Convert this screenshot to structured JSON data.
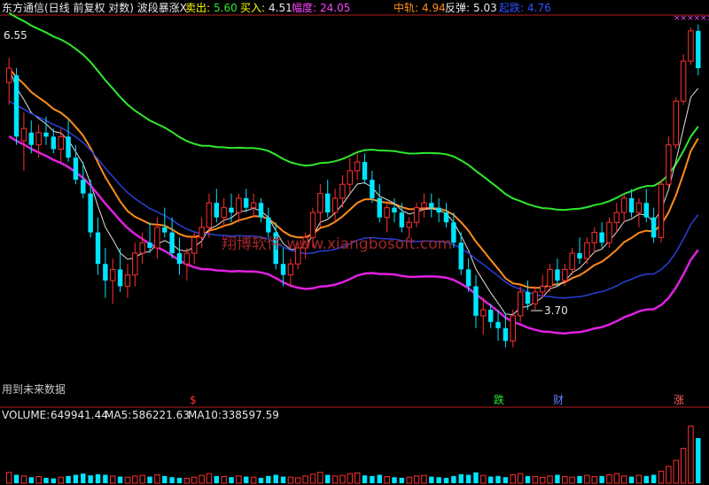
{
  "header": {
    "title": "东方通信(日线 前复权 对数) 波段暴涨X",
    "sell_label": "卖出:",
    "sell_value": "5.60",
    "buy_label": "买入:",
    "buy_value": "4.51",
    "amp_label": "幅度:",
    "amp_value": "24.05",
    "mid_label": "中轨:",
    "mid_value": "4.94",
    "rebound_label": "反弹:",
    "rebound_value": "5.03",
    "support_label": "起跌:",
    "support_value": "4.76"
  },
  "annotations": {
    "high": "6.55",
    "low": "3.70",
    "future_note": "用到未来数据",
    "watermark": "翔博软件 www.xiangbosoft.com",
    "signal_s": "$",
    "signal_fall": "跌",
    "signal_wealth": "财",
    "signal_rise": "涨",
    "x_marks": "××××××"
  },
  "volume_header": {
    "volume_label": "VOLUME:",
    "volume_value": "649941.44",
    "ma5_label": "MA5:",
    "ma5_value": "586221.63",
    "ma10_label": "MA10:",
    "ma10_value": "338597.59"
  },
  "colors": {
    "up": "#ff3030",
    "down": "#00e5ff",
    "green_line": "#2ee82e",
    "orange_line": "#ff8c1a",
    "white_line": "#e0e0e0",
    "blue_line": "#2a3fd8",
    "magenta_line": "#e020e0",
    "title": "#e8e8e8",
    "label_yellow": "#ffff00"
  },
  "chart_data": {
    "type": "candlestick",
    "price_range": [
      3.4,
      7.1
    ],
    "candles": [
      {
        "o": 6.2,
        "h": 6.55,
        "l": 5.9,
        "c": 6.4
      },
      {
        "o": 6.3,
        "h": 6.4,
        "l": 5.4,
        "c": 5.5
      },
      {
        "o": 5.45,
        "h": 5.8,
        "l": 5.1,
        "c": 5.6
      },
      {
        "o": 5.55,
        "h": 5.7,
        "l": 5.3,
        "c": 5.4
      },
      {
        "o": 5.4,
        "h": 5.65,
        "l": 5.25,
        "c": 5.55
      },
      {
        "o": 5.55,
        "h": 5.75,
        "l": 5.4,
        "c": 5.5
      },
      {
        "o": 5.5,
        "h": 5.6,
        "l": 5.3,
        "c": 5.35
      },
      {
        "o": 5.35,
        "h": 5.6,
        "l": 5.2,
        "c": 5.5
      },
      {
        "o": 5.5,
        "h": 5.7,
        "l": 5.2,
        "c": 5.25
      },
      {
        "o": 5.25,
        "h": 5.4,
        "l": 4.95,
        "c": 5.0
      },
      {
        "o": 5.0,
        "h": 5.2,
        "l": 4.8,
        "c": 4.85
      },
      {
        "o": 4.85,
        "h": 5.0,
        "l": 4.4,
        "c": 4.45
      },
      {
        "o": 4.45,
        "h": 4.6,
        "l": 4.05,
        "c": 4.15
      },
      {
        "o": 4.15,
        "h": 4.3,
        "l": 3.85,
        "c": 4.0
      },
      {
        "o": 4.0,
        "h": 4.2,
        "l": 3.8,
        "c": 4.1
      },
      {
        "o": 4.1,
        "h": 4.3,
        "l": 3.9,
        "c": 3.95
      },
      {
        "o": 3.95,
        "h": 4.15,
        "l": 3.85,
        "c": 4.05
      },
      {
        "o": 4.05,
        "h": 4.35,
        "l": 3.95,
        "c": 4.25
      },
      {
        "o": 4.25,
        "h": 4.45,
        "l": 4.15,
        "c": 4.35
      },
      {
        "o": 4.35,
        "h": 4.55,
        "l": 4.25,
        "c": 4.3
      },
      {
        "o": 4.3,
        "h": 4.6,
        "l": 4.2,
        "c": 4.5
      },
      {
        "o": 4.5,
        "h": 4.7,
        "l": 4.4,
        "c": 4.45
      },
      {
        "o": 4.45,
        "h": 4.6,
        "l": 4.2,
        "c": 4.25
      },
      {
        "o": 4.25,
        "h": 4.4,
        "l": 4.05,
        "c": 4.15
      },
      {
        "o": 4.15,
        "h": 4.3,
        "l": 4.0,
        "c": 4.25
      },
      {
        "o": 4.25,
        "h": 4.45,
        "l": 4.15,
        "c": 4.4
      },
      {
        "o": 4.4,
        "h": 4.6,
        "l": 4.3,
        "c": 4.5
      },
      {
        "o": 4.5,
        "h": 4.85,
        "l": 4.4,
        "c": 4.75
      },
      {
        "o": 4.75,
        "h": 4.9,
        "l": 4.55,
        "c": 4.6
      },
      {
        "o": 4.6,
        "h": 4.8,
        "l": 4.5,
        "c": 4.7
      },
      {
        "o": 4.7,
        "h": 4.85,
        "l": 4.55,
        "c": 4.65
      },
      {
        "o": 4.65,
        "h": 4.85,
        "l": 4.55,
        "c": 4.8
      },
      {
        "o": 4.8,
        "h": 4.9,
        "l": 4.65,
        "c": 4.7
      },
      {
        "o": 4.7,
        "h": 4.85,
        "l": 4.6,
        "c": 4.75
      },
      {
        "o": 4.75,
        "h": 4.8,
        "l": 4.55,
        "c": 4.6
      },
      {
        "o": 4.6,
        "h": 4.7,
        "l": 4.4,
        "c": 4.45
      },
      {
        "o": 4.45,
        "h": 4.55,
        "l": 4.1,
        "c": 4.15
      },
      {
        "o": 4.15,
        "h": 4.3,
        "l": 3.95,
        "c": 4.05
      },
      {
        "o": 4.05,
        "h": 4.2,
        "l": 3.95,
        "c": 4.15
      },
      {
        "o": 4.15,
        "h": 4.35,
        "l": 4.1,
        "c": 4.3
      },
      {
        "o": 4.3,
        "h": 4.45,
        "l": 4.2,
        "c": 4.4
      },
      {
        "o": 4.4,
        "h": 4.7,
        "l": 4.3,
        "c": 4.65
      },
      {
        "o": 4.65,
        "h": 4.95,
        "l": 4.5,
        "c": 4.85
      },
      {
        "o": 4.85,
        "h": 5.0,
        "l": 4.6,
        "c": 4.65
      },
      {
        "o": 4.65,
        "h": 4.9,
        "l": 4.55,
        "c": 4.8
      },
      {
        "o": 4.8,
        "h": 5.05,
        "l": 4.7,
        "c": 4.95
      },
      {
        "o": 4.95,
        "h": 5.25,
        "l": 4.85,
        "c": 5.1
      },
      {
        "o": 5.1,
        "h": 5.3,
        "l": 5.0,
        "c": 5.2
      },
      {
        "o": 5.2,
        "h": 5.3,
        "l": 4.95,
        "c": 5.0
      },
      {
        "o": 5.0,
        "h": 5.1,
        "l": 4.75,
        "c": 4.8
      },
      {
        "o": 4.8,
        "h": 4.95,
        "l": 4.55,
        "c": 4.6
      },
      {
        "o": 4.6,
        "h": 4.75,
        "l": 4.45,
        "c": 4.7
      },
      {
        "o": 4.7,
        "h": 4.8,
        "l": 4.55,
        "c": 4.65
      },
      {
        "o": 4.65,
        "h": 4.75,
        "l": 4.45,
        "c": 4.5
      },
      {
        "o": 4.5,
        "h": 4.6,
        "l": 4.4,
        "c": 4.55
      },
      {
        "o": 4.55,
        "h": 4.75,
        "l": 4.5,
        "c": 4.7
      },
      {
        "o": 4.7,
        "h": 4.85,
        "l": 4.6,
        "c": 4.75
      },
      {
        "o": 4.75,
        "h": 4.85,
        "l": 4.6,
        "c": 4.7
      },
      {
        "o": 4.7,
        "h": 4.8,
        "l": 4.55,
        "c": 4.65
      },
      {
        "o": 4.65,
        "h": 4.75,
        "l": 4.5,
        "c": 4.55
      },
      {
        "o": 4.55,
        "h": 4.65,
        "l": 4.3,
        "c": 4.35
      },
      {
        "o": 4.35,
        "h": 4.45,
        "l": 4.05,
        "c": 4.1
      },
      {
        "o": 4.1,
        "h": 4.2,
        "l": 3.9,
        "c": 3.95
      },
      {
        "o": 3.95,
        "h": 4.05,
        "l": 3.6,
        "c": 3.7
      },
      {
        "o": 3.7,
        "h": 3.85,
        "l": 3.55,
        "c": 3.75
      },
      {
        "o": 3.75,
        "h": 3.8,
        "l": 3.6,
        "c": 3.65
      },
      {
        "o": 3.65,
        "h": 3.75,
        "l": 3.5,
        "c": 3.6
      },
      {
        "o": 3.6,
        "h": 3.72,
        "l": 3.45,
        "c": 3.5
      },
      {
        "o": 3.5,
        "h": 3.75,
        "l": 3.45,
        "c": 3.7
      },
      {
        "o": 3.7,
        "h": 3.95,
        "l": 3.65,
        "c": 3.9
      },
      {
        "o": 3.9,
        "h": 4.0,
        "l": 3.75,
        "c": 3.8
      },
      {
        "o": 3.8,
        "h": 3.95,
        "l": 3.75,
        "c": 3.9
      },
      {
        "o": 3.9,
        "h": 4.05,
        "l": 3.85,
        "c": 3.95
      },
      {
        "o": 3.95,
        "h": 4.15,
        "l": 3.9,
        "c": 4.1
      },
      {
        "o": 4.1,
        "h": 4.2,
        "l": 3.95,
        "c": 4.0
      },
      {
        "o": 4.0,
        "h": 4.15,
        "l": 3.95,
        "c": 4.1
      },
      {
        "o": 4.1,
        "h": 4.3,
        "l": 4.05,
        "c": 4.25
      },
      {
        "o": 4.25,
        "h": 4.4,
        "l": 4.15,
        "c": 4.2
      },
      {
        "o": 4.2,
        "h": 4.4,
        "l": 4.15,
        "c": 4.35
      },
      {
        "o": 4.35,
        "h": 4.5,
        "l": 4.25,
        "c": 4.45
      },
      {
        "o": 4.45,
        "h": 4.55,
        "l": 4.3,
        "c": 4.35
      },
      {
        "o": 4.35,
        "h": 4.6,
        "l": 4.3,
        "c": 4.55
      },
      {
        "o": 4.55,
        "h": 4.75,
        "l": 4.45,
        "c": 4.65
      },
      {
        "o": 4.65,
        "h": 4.85,
        "l": 4.55,
        "c": 4.8
      },
      {
        "o": 4.8,
        "h": 4.9,
        "l": 4.6,
        "c": 4.65
      },
      {
        "o": 4.65,
        "h": 4.8,
        "l": 4.5,
        "c": 4.75
      },
      {
        "o": 4.75,
        "h": 4.9,
        "l": 4.55,
        "c": 4.6
      },
      {
        "o": 4.6,
        "h": 4.7,
        "l": 4.35,
        "c": 4.4
      },
      {
        "o": 4.4,
        "h": 5.0,
        "l": 4.35,
        "c": 4.95
      },
      {
        "o": 4.95,
        "h": 5.5,
        "l": 4.9,
        "c": 5.4
      },
      {
        "o": 5.4,
        "h": 6.0,
        "l": 5.35,
        "c": 5.95
      },
      {
        "o": 5.95,
        "h": 6.6,
        "l": 5.9,
        "c": 6.5
      },
      {
        "o": 6.5,
        "h": 7.0,
        "l": 6.45,
        "c": 6.95
      },
      {
        "o": 6.95,
        "h": 7.05,
        "l": 6.3,
        "c": 6.4
      }
    ],
    "volume": [
      18,
      14,
      12,
      10,
      11,
      9,
      8,
      10,
      12,
      14,
      16,
      13,
      15,
      14,
      12,
      11,
      10,
      12,
      13,
      11,
      14,
      12,
      10,
      9,
      8,
      10,
      13,
      16,
      12,
      11,
      10,
      12,
      11,
      10,
      9,
      12,
      14,
      11,
      10,
      9,
      12,
      15,
      18,
      14,
      12,
      13,
      16,
      17,
      13,
      12,
      14,
      11,
      10,
      9,
      10,
      12,
      13,
      11,
      10,
      9,
      12,
      15,
      14,
      18,
      13,
      11,
      12,
      10,
      14,
      16,
      12,
      11,
      10,
      12,
      14,
      11,
      10,
      12,
      13,
      11,
      12,
      14,
      16,
      12,
      11,
      13,
      12,
      14,
      20,
      28,
      38,
      58,
      95,
      75
    ],
    "volume_range": [
      0,
      100
    ]
  }
}
